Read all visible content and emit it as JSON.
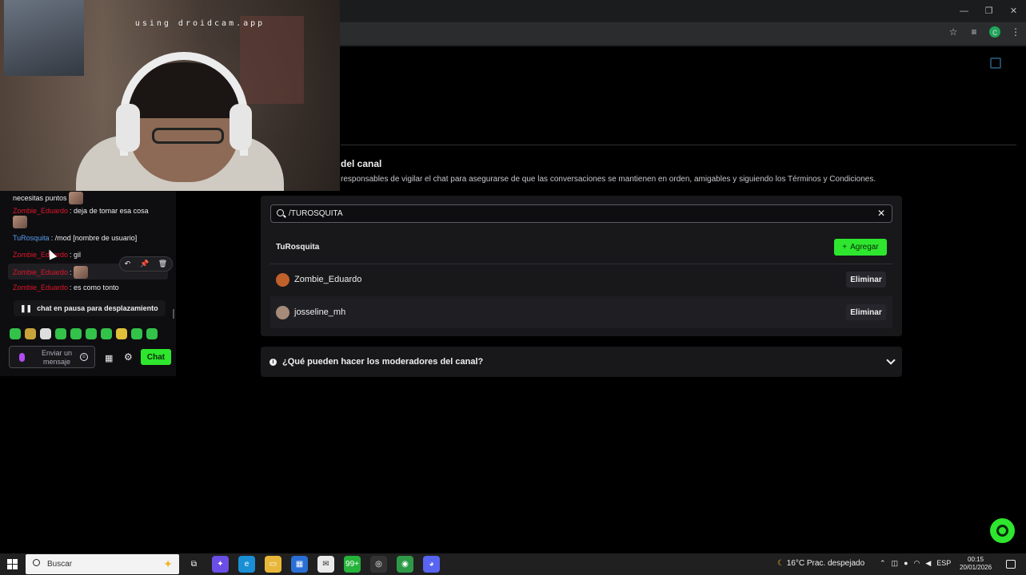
{
  "browser": {
    "window_controls": [
      "—",
      "❐",
      "✕"
    ],
    "toolbar_icons": [
      "☆",
      "≡"
    ],
    "profile_initial": "c"
  },
  "webcam": {
    "caption": "using droidcam.app"
  },
  "chat": {
    "messages": [
      {
        "user": "",
        "text": "necesitas puntos"
      },
      {
        "user": "Zombie_Eduardo",
        "text": ": deja de tomar esa cosa"
      },
      {
        "user": "TuRosquita",
        "text": ": /mod [nombre de usuario]"
      },
      {
        "user": "Zombie_Eduardo",
        "text": ": gil"
      },
      {
        "user": "Zombie_Eduardo",
        "text": ":"
      },
      {
        "user": "Zombie_Eduardo",
        "text": ": es como tonto"
      }
    ],
    "hover_actions": [
      "↶",
      "📌",
      "🗑"
    ],
    "paused_label": "chat en pausa para desplazamiento",
    "input_placeholder": "Enviar un mensaje",
    "send_label": "Chat"
  },
  "mods": {
    "title_fragment": "del canal",
    "description_fragment": "responsables de vigilar el chat para asegurarse de que las conversaciones se mantienen en orden, amigables y siguiendo los Términos y Condiciones.",
    "search_value": "/TUROSQUITA",
    "search_result": "TuRosquita",
    "add_label": "Agregar",
    "list": [
      {
        "name": "Zombie_Eduardo",
        "action": "Eliminar",
        "avatar_color": "#c0602a"
      },
      {
        "name": "josseline_mh",
        "action": "Eliminar",
        "avatar_color": "#a58a7a"
      }
    ],
    "faq_label": "¿Qué pueden hacer los moderadores del canal?"
  },
  "taskbar": {
    "search_placeholder": "Buscar",
    "weather": "16°C  Prac. despejado",
    "language": "ESP",
    "time": "00:15",
    "date": "20/01/2026",
    "apps": [
      {
        "name": "task-view",
        "color": "#202020",
        "glyph": "⧉"
      },
      {
        "name": "copilot",
        "color": "#6b4ee6",
        "glyph": "✦"
      },
      {
        "name": "edge",
        "color": "#1a8fd6",
        "glyph": "e"
      },
      {
        "name": "explorer",
        "color": "#e8b73a",
        "glyph": "▭"
      },
      {
        "name": "store",
        "color": "#2a6fd6",
        "glyph": "▦"
      },
      {
        "name": "mail",
        "color": "#eaeaea",
        "glyph": "✉"
      },
      {
        "name": "whatsapp",
        "color": "#25b33a",
        "glyph": "99+"
      },
      {
        "name": "github",
        "color": "#333333",
        "glyph": "◎"
      },
      {
        "name": "chrome",
        "color": "#2e9a47",
        "glyph": "◉"
      },
      {
        "name": "discord",
        "color": "#5865f2",
        "glyph": "◕"
      }
    ]
  }
}
